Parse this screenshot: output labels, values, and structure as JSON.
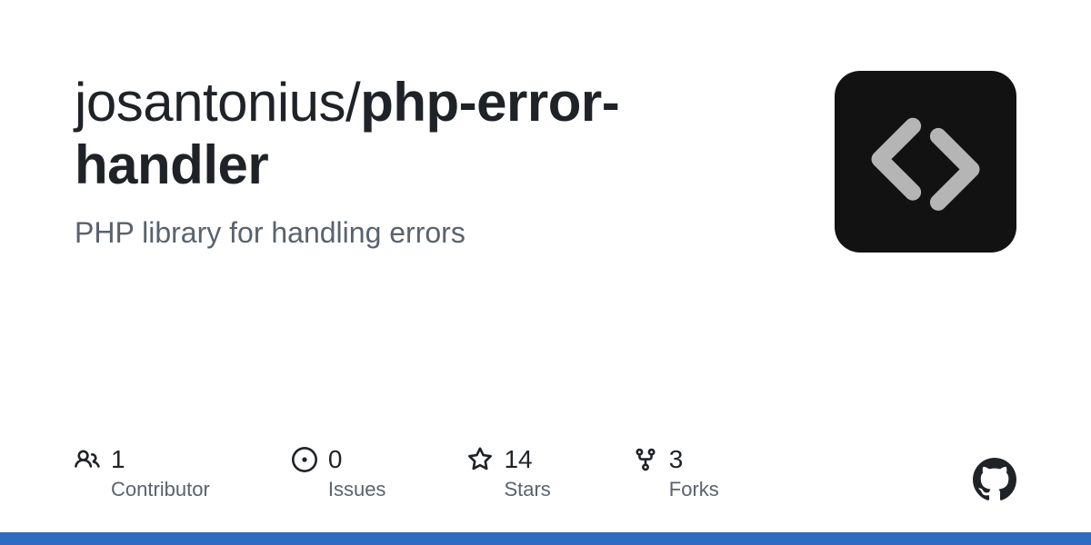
{
  "repo": {
    "owner": "josantonius",
    "separator": "/",
    "name": "php-error-handler",
    "description": "PHP library for handling errors"
  },
  "stats": [
    {
      "icon": "people-icon",
      "value": "1",
      "label": "Contributor"
    },
    {
      "icon": "issue-icon",
      "value": "0",
      "label": "Issues"
    },
    {
      "icon": "star-icon",
      "value": "14",
      "label": "Stars"
    },
    {
      "icon": "fork-icon",
      "value": "3",
      "label": "Forks"
    }
  ]
}
